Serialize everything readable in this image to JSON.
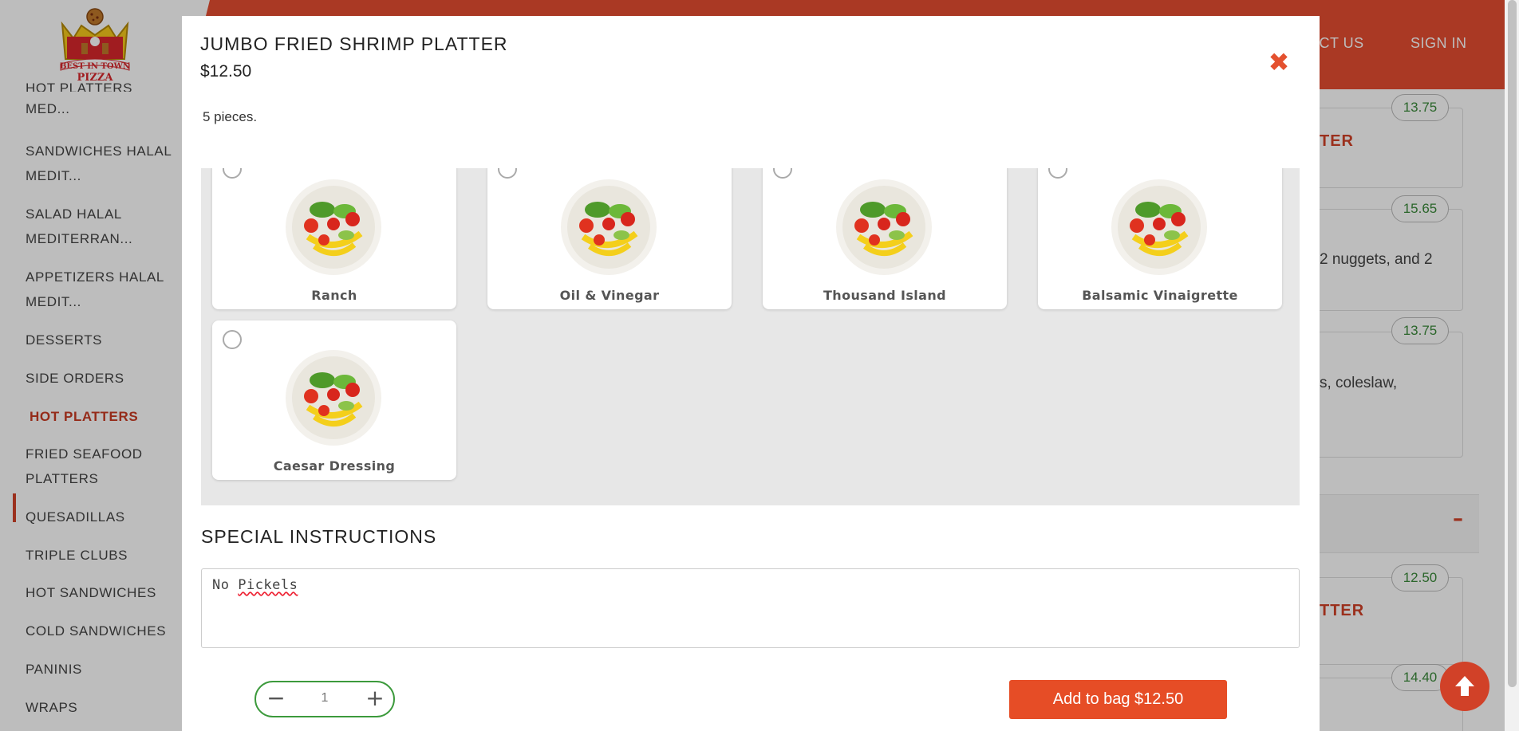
{
  "brand": {
    "logo_alt": "Best In Town Pizza",
    "logo_line1": "BEST IN TOWN",
    "logo_line2": "PIZZA"
  },
  "nav": {
    "contact": "ACT US",
    "signin": "SIGN IN"
  },
  "sidebar": {
    "partial_top": "HOT PLATTERS HALAL",
    "items": [
      {
        "label": "MED..."
      },
      {
        "label": "SANDWICHES HALAL MEDIT..."
      },
      {
        "label": "SALAD HALAL MEDITERRAN..."
      },
      {
        "label": "APPETIZERS HALAL MEDIT..."
      },
      {
        "label": "DESSERTS"
      },
      {
        "label": "SIDE ORDERS"
      },
      {
        "label": "HOT PLATTERS"
      },
      {
        "label": "FRIED SEAFOOD PLATTERS"
      },
      {
        "label": "QUESADILLAS"
      },
      {
        "label": "TRIPLE CLUBS"
      },
      {
        "label": "HOT SANDWICHES"
      },
      {
        "label": "COLD SANDWICHES"
      },
      {
        "label": "PANINIS"
      },
      {
        "label": "WRAPS"
      }
    ],
    "active_index": 6
  },
  "background": {
    "cards": [
      {
        "price": "13.75",
        "title": "TER",
        "desc": ""
      },
      {
        "price": "15.65",
        "title": "",
        "desc": "2 nuggets, and 2"
      },
      {
        "price": "13.75",
        "title": "",
        "desc": "s, coleslaw,"
      },
      {
        "price": "12.50",
        "title": "TTER",
        "desc": ""
      },
      {
        "price": "14.40",
        "title": "",
        "desc": ""
      }
    ],
    "collapse_symbol": "–"
  },
  "modal": {
    "title": "JUMBO FRIED SHRIMP PLATTER",
    "price": "$12.50",
    "description": "5 pieces.",
    "options": [
      {
        "label": "Ranch"
      },
      {
        "label": "Oil & Vinegar"
      },
      {
        "label": "Thousand Island"
      },
      {
        "label": "Balsamic Vinaigrette"
      },
      {
        "label": "Caesar Dressing"
      }
    ],
    "special_instructions_heading": "SPECIAL INSTRUCTIONS",
    "special_instructions_prefix": "No ",
    "special_instructions_word": "Pickels",
    "quantity": "1",
    "add_button": "Add to bag $12.50"
  },
  "colors": {
    "brand": "#e64d31",
    "accent_green": "#3c9a3c",
    "accent_red": "#d14128"
  },
  "icons": {
    "close": "close-icon",
    "minus": "minus-icon",
    "plus": "plus-icon",
    "scroll_top": "arrow-up-icon"
  }
}
